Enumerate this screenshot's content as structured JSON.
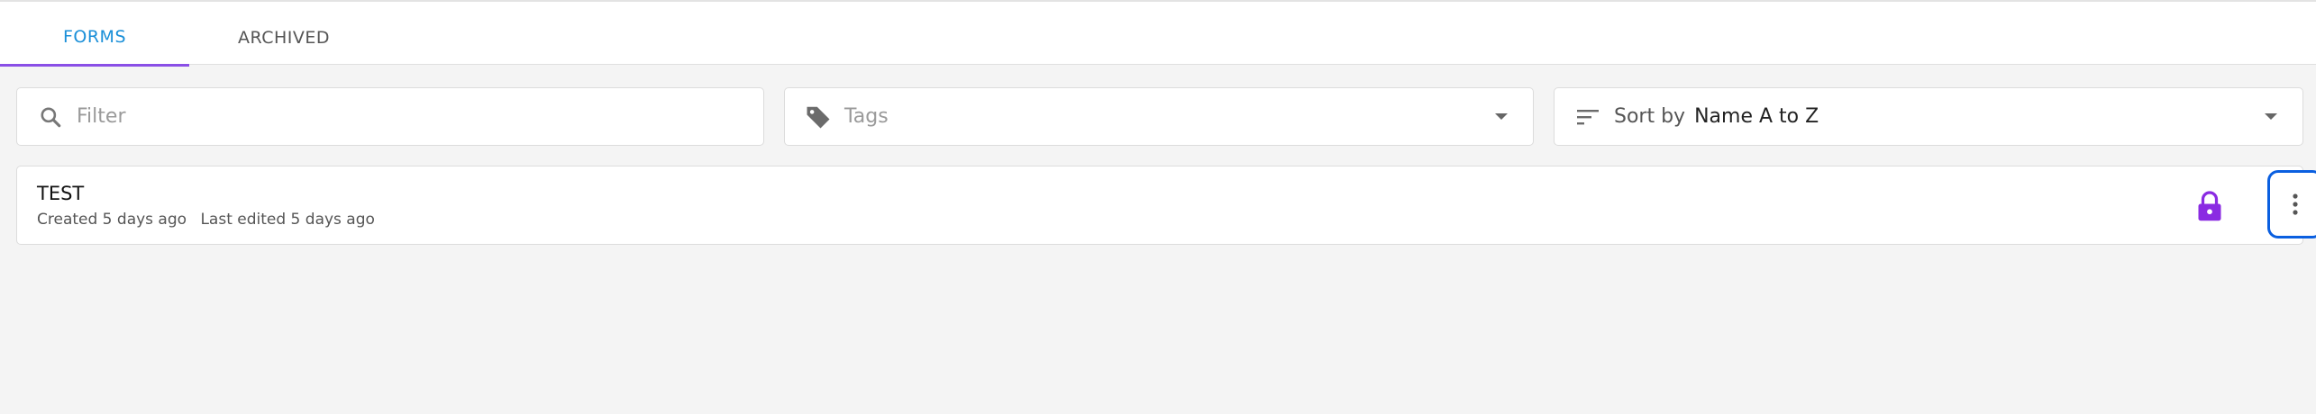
{
  "tabs": [
    {
      "label": "FORMS",
      "active": true
    },
    {
      "label": "ARCHIVED",
      "active": false
    }
  ],
  "filter": {
    "placeholder": "Filter",
    "value": "",
    "icon": "search-icon"
  },
  "tags": {
    "label": "Tags",
    "icon": "tag-icon"
  },
  "sort": {
    "prefix": "Sort by",
    "value": "Name A to Z",
    "icon": "sort-icon"
  },
  "forms": [
    {
      "title": "TEST",
      "created": "Created 5 days ago",
      "edited": "Last edited 5 days ago",
      "locked": true
    }
  ],
  "colors": {
    "accent": "#1a8fd8",
    "tab_indicator": "#8a4fe6",
    "lock": "#8a2be2",
    "focus_ring": "#0a5fe0"
  }
}
